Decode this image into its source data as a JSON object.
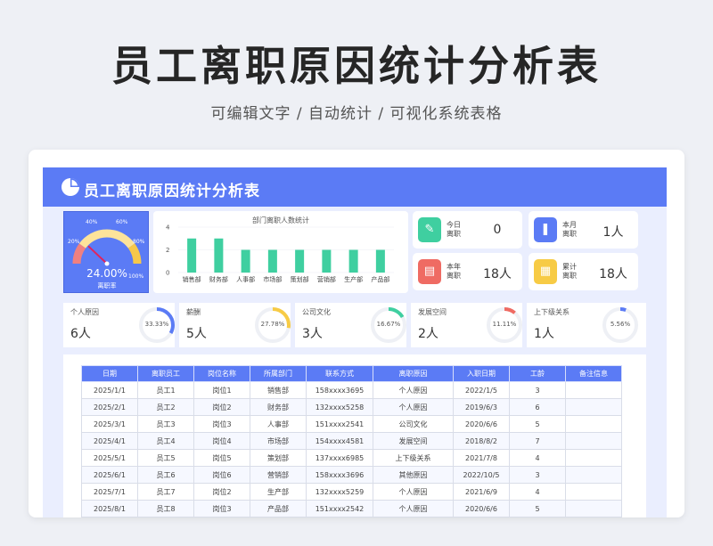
{
  "hero": {
    "title": "员工离职原因统计分析表",
    "subtitle": "可编辑文字 / 自动统计 / 可视化系统表格"
  },
  "banner": {
    "title": "员工离职原因统计分析表",
    "icon": "pie-chart-icon"
  },
  "gauge": {
    "value_label": "24.00%",
    "value": 0.24,
    "name": "离职率",
    "scale_labels": [
      "0%",
      "20%",
      "40%",
      "60%",
      "80%",
      "100%"
    ],
    "colors": {
      "low": "#f08080",
      "mid": "#fde39a",
      "high": "#f7c84a",
      "needle": "#e0245e"
    }
  },
  "chart_data": {
    "type": "bar",
    "title": "部门离职人数统计",
    "categories": [
      "销售部",
      "财务部",
      "人事部",
      "市场部",
      "策划部",
      "营销部",
      "生产部",
      "产品部"
    ],
    "values": [
      3,
      3,
      2,
      2,
      2,
      2,
      2,
      2
    ],
    "ylim": [
      0,
      4
    ],
    "yticks": [
      0,
      2,
      4
    ],
    "bar_color": "#3fcfa0"
  },
  "stats": [
    {
      "label": "今日离职",
      "value": "0",
      "icon": "pencil-icon",
      "color": "#3fcfa0"
    },
    {
      "label": "本月离职",
      "value": "1人",
      "icon": "document-icon",
      "color": "#5b7bf5"
    },
    {
      "label": "本年离职",
      "value": "18人",
      "icon": "chat-icon",
      "color": "#ef6b63"
    },
    {
      "label": "累计离职",
      "value": "18人",
      "icon": "grid-icon",
      "color": "#f7cb45"
    }
  ],
  "reasons": [
    {
      "name": "个人原因",
      "count": "6人",
      "pct_label": "33.33%",
      "pct": 0.3333,
      "color": "#5b7bf5"
    },
    {
      "name": "薪酬",
      "count": "5人",
      "pct_label": "27.78%",
      "pct": 0.2778,
      "color": "#f7cb45"
    },
    {
      "name": "公司文化",
      "count": "3人",
      "pct_label": "16.67%",
      "pct": 0.1667,
      "color": "#3fcfa0"
    },
    {
      "name": "发展空间",
      "count": "2人",
      "pct_label": "11.11%",
      "pct": 0.1111,
      "color": "#ef6b63"
    },
    {
      "name": "上下级关系",
      "count": "1人",
      "pct_label": "5.56%",
      "pct": 0.0556,
      "color": "#5b7bf5"
    }
  ],
  "table": {
    "columns": [
      "日期",
      "离职员工",
      "岗位名称",
      "所属部门",
      "联系方式",
      "离职原因",
      "入职日期",
      "工龄",
      "备注信息"
    ],
    "rows": [
      [
        "2025/1/1",
        "员工1",
        "岗位1",
        "销售部",
        "158xxxx3695",
        "个人原因",
        "2022/1/5",
        "3",
        ""
      ],
      [
        "2025/2/1",
        "员工2",
        "岗位2",
        "财务部",
        "132xxxx5258",
        "个人原因",
        "2019/6/3",
        "6",
        ""
      ],
      [
        "2025/3/1",
        "员工3",
        "岗位3",
        "人事部",
        "151xxxx2541",
        "公司文化",
        "2020/6/6",
        "5",
        ""
      ],
      [
        "2025/4/1",
        "员工4",
        "岗位4",
        "市场部",
        "154xxxx4581",
        "发展空间",
        "2018/8/2",
        "7",
        ""
      ],
      [
        "2025/5/1",
        "员工5",
        "岗位5",
        "策划部",
        "137xxxx6985",
        "上下级关系",
        "2021/7/8",
        "4",
        ""
      ],
      [
        "2025/6/1",
        "员工6",
        "岗位6",
        "营销部",
        "158xxxx3696",
        "其他原因",
        "2022/10/5",
        "3",
        ""
      ],
      [
        "2025/7/1",
        "员工7",
        "岗位2",
        "生产部",
        "132xxxx5259",
        "个人原因",
        "2021/6/9",
        "4",
        ""
      ],
      [
        "2025/8/1",
        "员工8",
        "岗位3",
        "产品部",
        "151xxxx2542",
        "个人原因",
        "2020/6/6",
        "5",
        ""
      ]
    ]
  }
}
